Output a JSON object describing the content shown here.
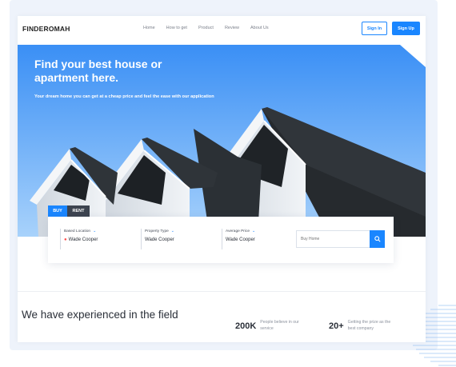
{
  "nav": {
    "logo": "FINDEROMAH",
    "links": [
      "Home",
      "How to get",
      "Product",
      "Review",
      "About Us"
    ],
    "sign_in": "Sign In",
    "sign_up": "Sign Up"
  },
  "hero": {
    "title": "Find your best house or apartment here.",
    "subtitle": "Your dream home you can get at a cheap price and feel the ease with our application"
  },
  "search": {
    "tabs": [
      "BUY",
      "RENT"
    ],
    "fields": [
      {
        "label": "Based Location",
        "value": "Wade Cooper"
      },
      {
        "label": "Property Type",
        "value": "Wade Cooper"
      },
      {
        "label": "Average Price",
        "value": "Wade Cooper"
      }
    ],
    "placeholder": "Buy Home"
  },
  "stats": {
    "heading": "We have experienced in the field",
    "items": [
      {
        "value": "200K",
        "text": "People believe in our service"
      },
      {
        "value": "20+",
        "text": "Getting the prize as the best company"
      }
    ]
  },
  "colors": {
    "accent": "#1a86ff",
    "sky_top": "#3a95f7",
    "sky_bottom": "#9fcdfb",
    "roof": "#2e3236",
    "wall": "#e8ecf0"
  },
  "icons": [
    "chevron-down-icon",
    "location-pin-icon",
    "search-icon"
  ]
}
